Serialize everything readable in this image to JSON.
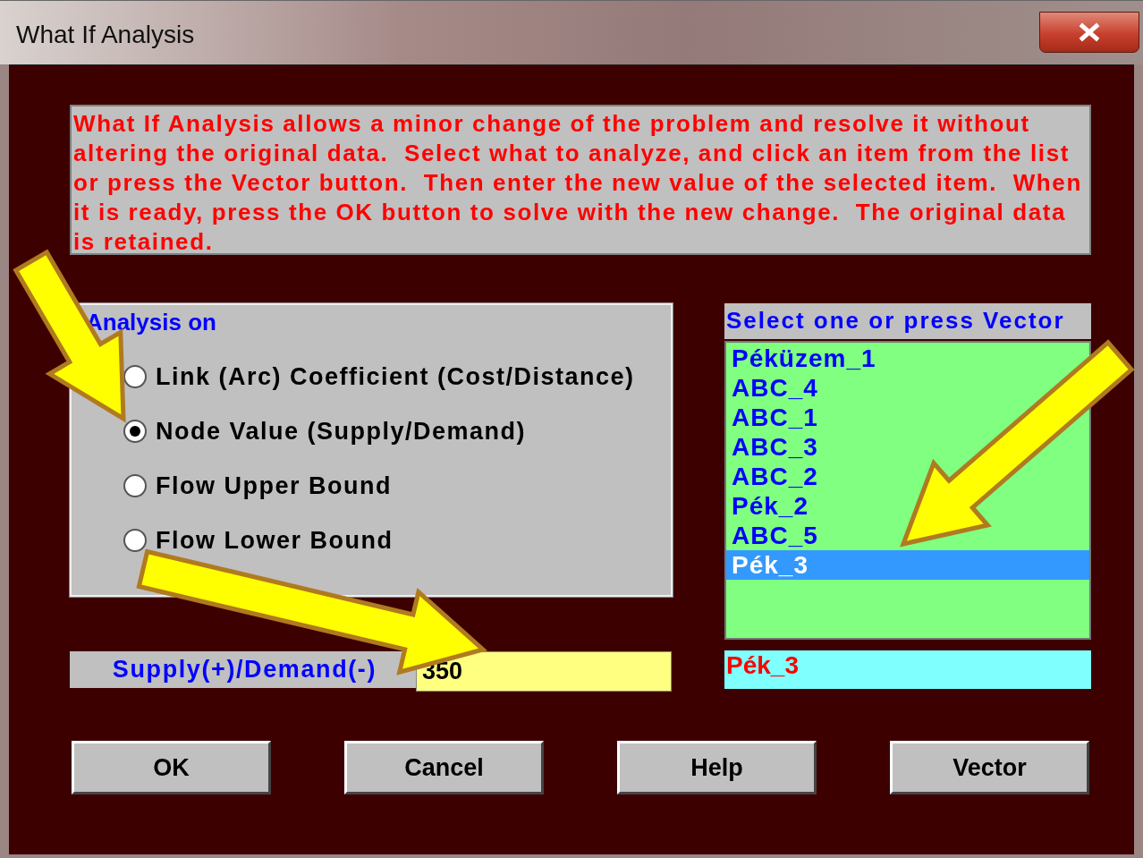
{
  "window": {
    "title": "What If Analysis"
  },
  "description": "What If Analysis allows a minor change of the problem and resolve it without altering the original data.  Select what to analyze, and click an item from the list or press the Vector button.  Then enter the new value of the selected item.  When it is ready, press the OK button to solve with the new change.  The original data is retained.",
  "analysis_on": {
    "title": "Analysis on",
    "options": [
      {
        "label": "Link (Arc) Coefficient (Cost/Distance)",
        "selected": false
      },
      {
        "label": "Node Value (Supply/Demand)",
        "selected": true
      },
      {
        "label": "Flow Upper Bound",
        "selected": false
      },
      {
        "label": "Flow Lower Bound",
        "selected": false
      }
    ]
  },
  "item_list": {
    "title": "Select one or press Vector",
    "items": [
      {
        "label": "Péküzem_1",
        "selected": false
      },
      {
        "label": "ABC_4",
        "selected": false
      },
      {
        "label": "ABC_1",
        "selected": false
      },
      {
        "label": "ABC_3",
        "selected": false
      },
      {
        "label": "ABC_2",
        "selected": false
      },
      {
        "label": "Pék_2",
        "selected": false
      },
      {
        "label": "ABC_5",
        "selected": false
      },
      {
        "label": "Pék_3",
        "selected": true
      }
    ]
  },
  "value_field": {
    "label": "Supply(+)/Demand(-)",
    "value": "350"
  },
  "selected_item": "Pék_3",
  "buttons": [
    "OK",
    "Cancel",
    "Help",
    "Vector"
  ]
}
